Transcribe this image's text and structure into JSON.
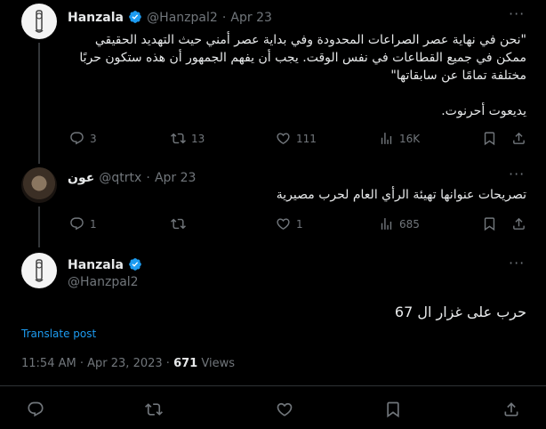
{
  "tweet1": {
    "name": "Hanzala",
    "handle": "@Hanzpal2",
    "dot": "·",
    "date": "Apr 23",
    "line1": "\"نحن في نهاية عصر الصراعات المحدودة وفي بداية عصر أمني حيث التهديد الحقيقي",
    "line2": "ممكن في جميع القطاعات في نفس الوقت. يجب أن يفهم الجمهور أن هذه ستكون حربًا",
    "line3": "مختلفة تمامًا عن سابقاتها\"",
    "line4": "يديعوت أحرنوت.",
    "replies": "3",
    "retweets": "13",
    "likes": "111",
    "views": "16K"
  },
  "tweet2": {
    "name": "عون",
    "handle": "@qtrtx",
    "dot": "·",
    "date": "Apr 23",
    "text": "تصريحات عنوانها تهيئة الرأي العام لحرب مصيرية",
    "replies": "1",
    "retweets": "",
    "likes": "1",
    "views": "685"
  },
  "tweet3": {
    "name": "Hanzala",
    "handle": "@Hanzpal2",
    "text": "حرب على غزار ال 67",
    "translate": "Translate post",
    "time": "11:54 AM",
    "dot": "·",
    "date": "Apr 23, 2023",
    "dot2": "·",
    "views_count": "671",
    "views_label": "Views"
  },
  "icons": {
    "more": "more-horizontal-icon",
    "verified": "verified-badge-icon",
    "reply": "reply-icon",
    "retweet": "retweet-icon",
    "like": "like-icon",
    "views": "views-icon",
    "bookmark": "bookmark-icon",
    "share": "share-icon"
  },
  "colors": {
    "background": "#000000",
    "text": "#e7e9ea",
    "muted": "#71767b",
    "accent": "#1d9bf0",
    "divider": "#2f3336"
  }
}
